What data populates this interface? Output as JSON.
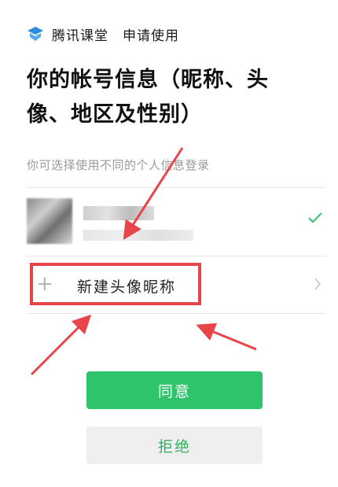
{
  "header": {
    "app_name": "腾讯课堂",
    "request_text": "申请使用",
    "logo_icon": "tencent-classroom-logo",
    "logo_color": "#2b8cdc"
  },
  "title": "你的帐号信息（昵称、头像、地区及性别）",
  "subtitle": "你可选择使用不同的个人信息登录",
  "account": {
    "selected": true,
    "check_color": "#2fc46b"
  },
  "new_profile": {
    "icon": "plus-icon",
    "plus": "+",
    "label": "新建头像昵称",
    "chevron": "chevron-right-icon"
  },
  "buttons": {
    "agree": "同意",
    "refuse": "拒绝"
  },
  "colors": {
    "primary": "#2fc46b",
    "annotation": "#e8454a"
  }
}
